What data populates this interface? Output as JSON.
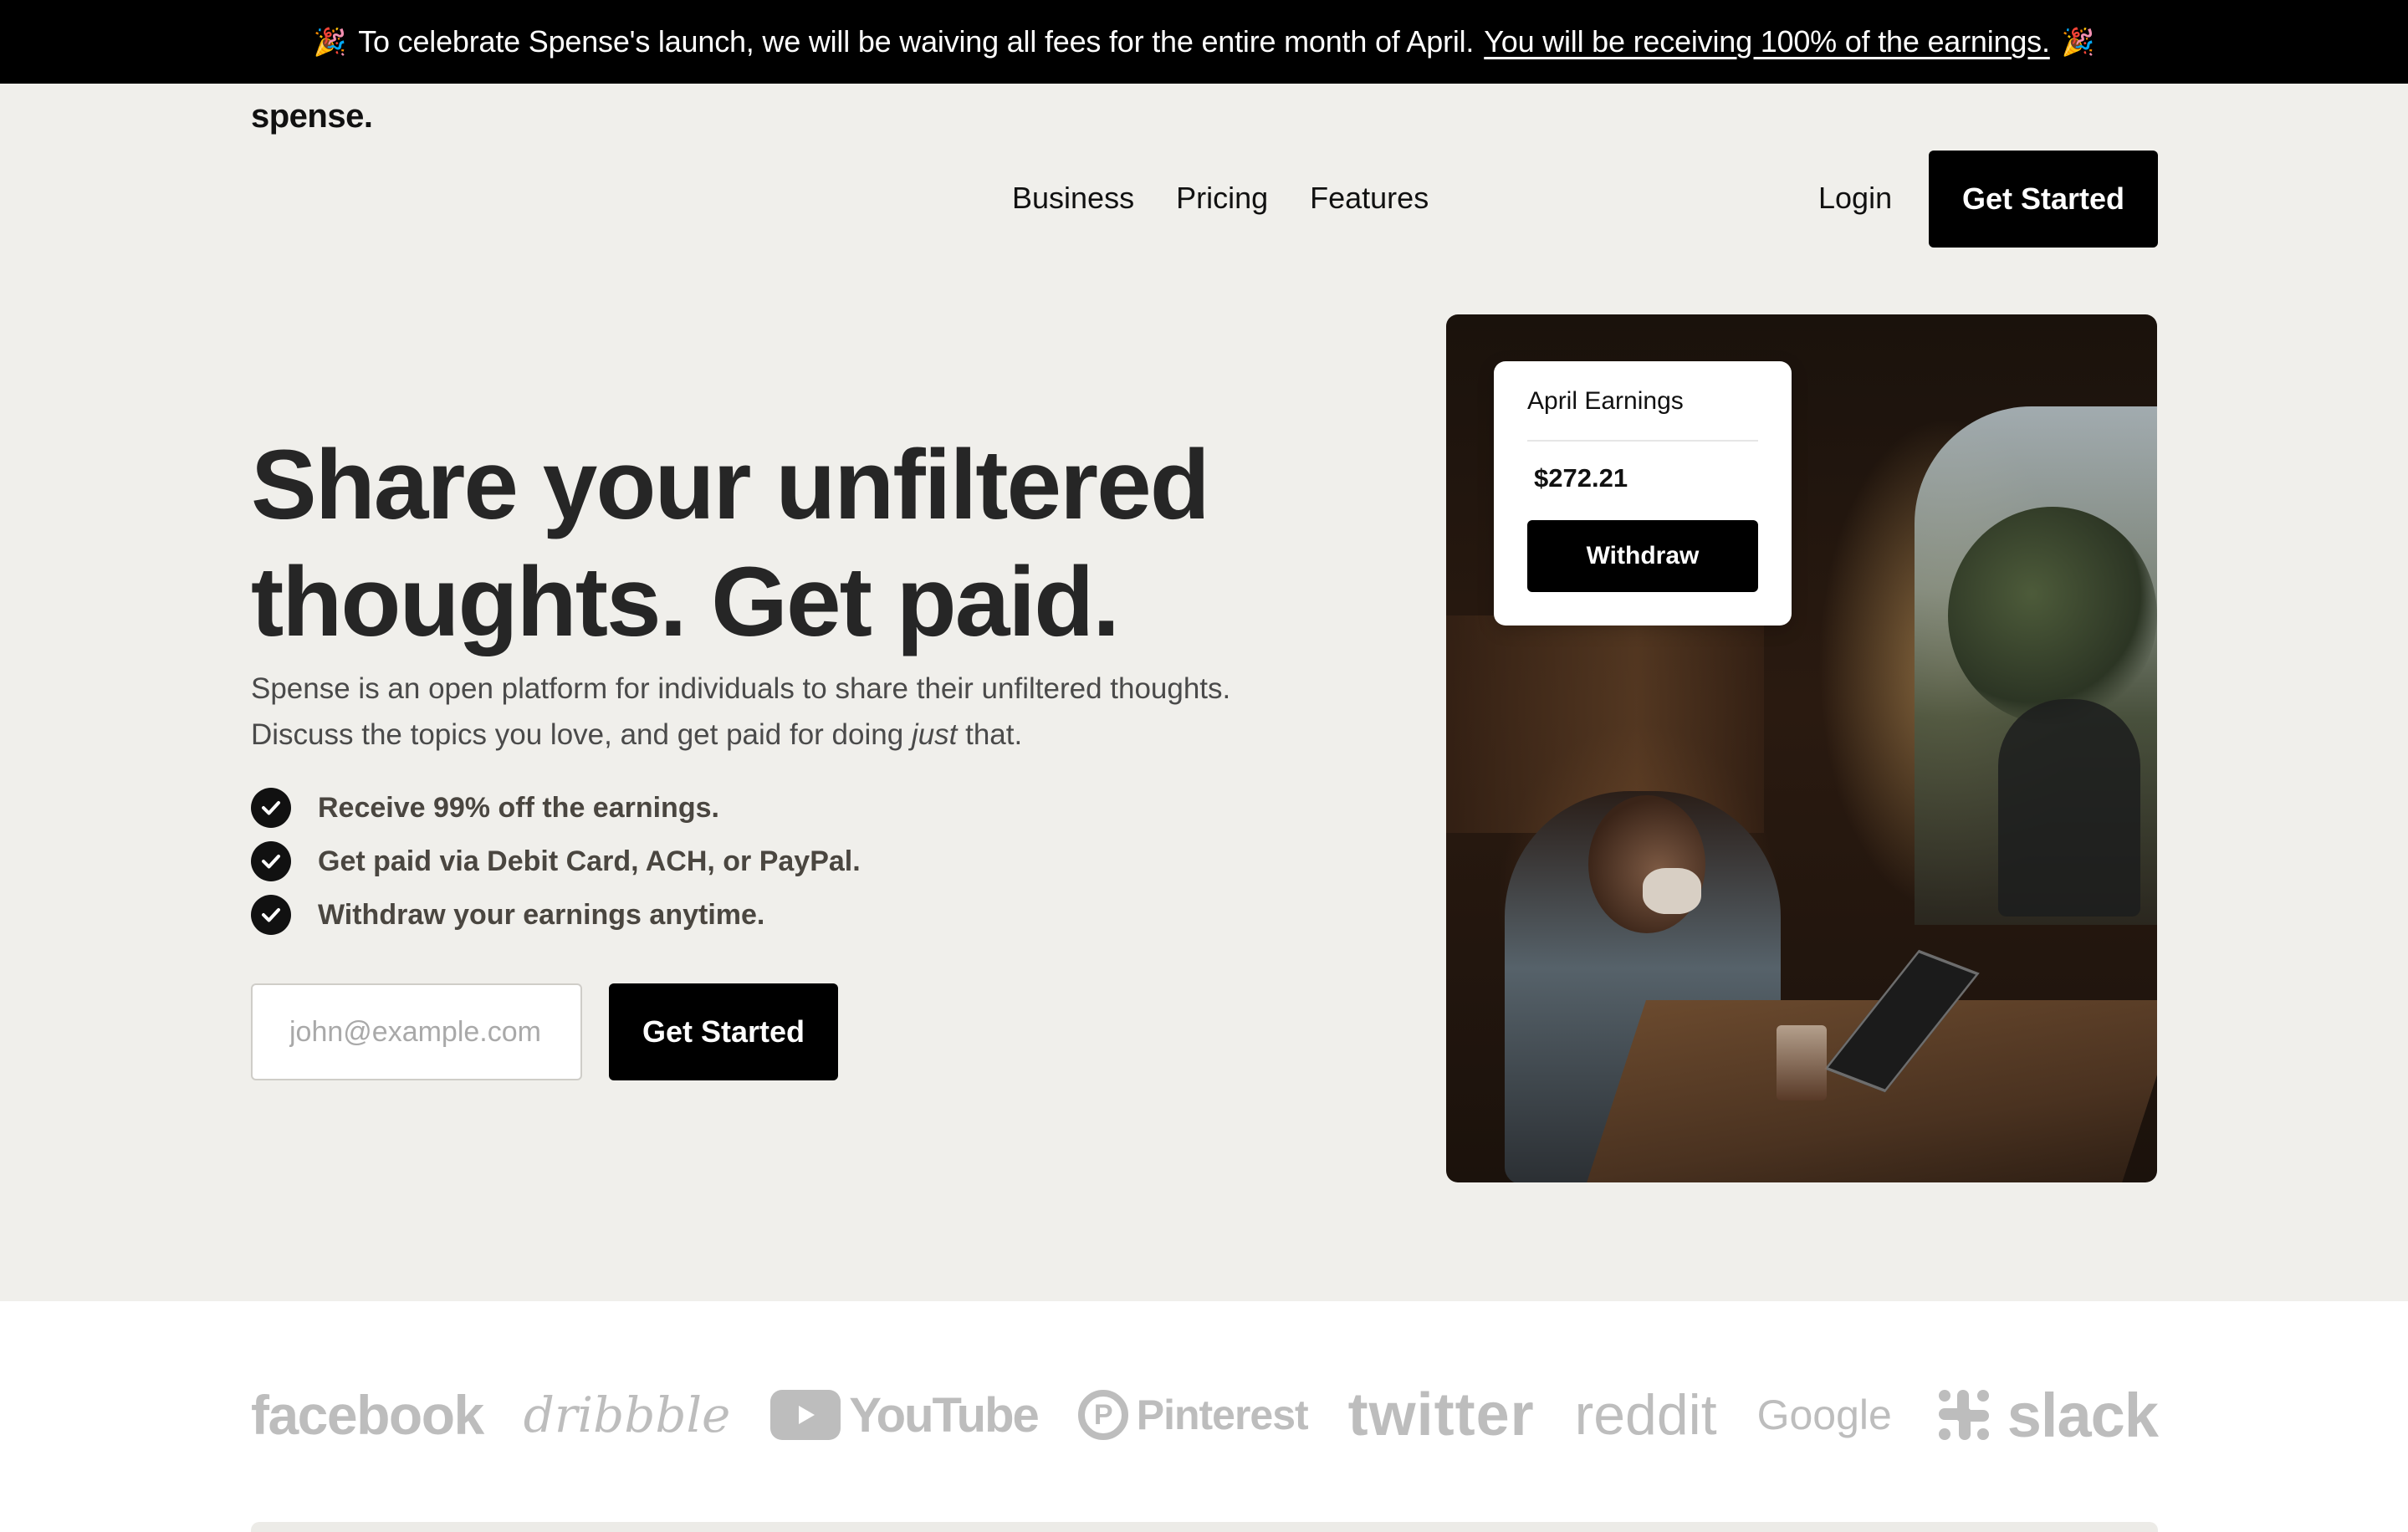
{
  "announcement": {
    "text": "To celebrate Spense's launch, we will be waiving all fees for the entire month of April.",
    "link": "You will be receiving 100% of the earnings.",
    "emoji": "🎉"
  },
  "header": {
    "logo": "spense.",
    "nav": [
      "Business",
      "Pricing",
      "Features"
    ],
    "login": "Login",
    "cta": "Get Started"
  },
  "hero": {
    "title_line1": "Share your unfiltered",
    "title_line2": "thoughts. Get paid.",
    "sub_line1": "Spense is an open platform for individuals to share their unfiltered thoughts.",
    "sub_line2_a": "Discuss the topics you love, and get paid for doing ",
    "sub_line2_em": "just",
    "sub_line2_b": " that.",
    "features": [
      "Receive 99% off the earnings.",
      "Get paid via Debit Card, ACH, or PayPal.",
      "Withdraw your earnings anytime."
    ],
    "email_placeholder": "john@example.com",
    "cta": "Get Started"
  },
  "earnings_card": {
    "label": "April Earnings",
    "amount": "$272.21",
    "button": "Withdraw"
  },
  "logos": {
    "facebook": "facebook",
    "dribbble": "dribbble",
    "youtube": "YouTube",
    "pinterest": "Pinterest",
    "twitter": "twitter",
    "reddit": "reddit",
    "google": "Google",
    "slack": "slack"
  }
}
